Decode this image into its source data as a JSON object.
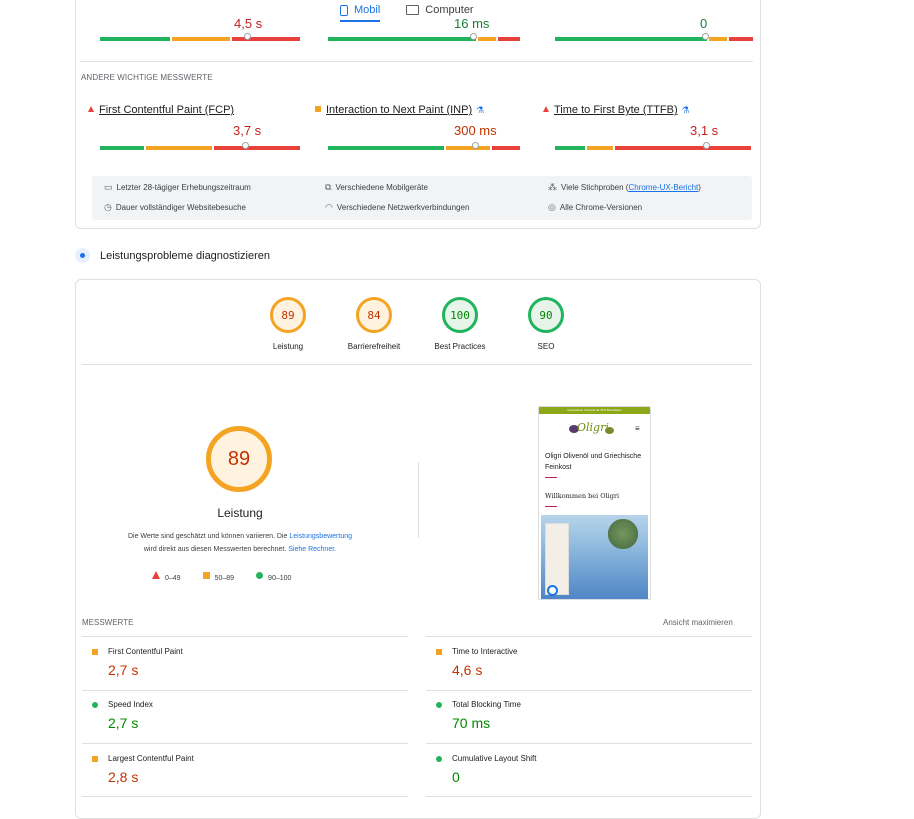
{
  "tabs": [
    {
      "label": "Mobil",
      "active": true
    },
    {
      "label": "Computer",
      "active": false
    }
  ],
  "top_values": [
    "4,5 s",
    "16 ms",
    "0"
  ],
  "other_metrics": {
    "heading": "ANDERE WICHTIGE MESSWERTE",
    "items": [
      {
        "name": "First Contentful Paint (FCP)",
        "value": "3,7 s",
        "status": "poor",
        "experimental": false
      },
      {
        "name": "Interaction to Next Paint (INP)",
        "value": "300 ms",
        "status": "needs-improvement",
        "experimental": true
      },
      {
        "name": "Time to First Byte (TTFB)",
        "value": "3,1 s",
        "status": "poor",
        "experimental": true
      }
    ]
  },
  "info": {
    "period": "Letzter 28-tägiger Erhebungszeitraum",
    "devices": "Verschiedene Mobilgeräte",
    "samples_prefix": "Viele Stichproben (",
    "samples_link": "Chrome-UX-Bericht",
    "samples_suffix": ")",
    "duration": "Dauer vollständiger Websitebesuche",
    "network": "Verschiedene Netzwerkverbindungen",
    "versions": "Alle Chrome-Versionen"
  },
  "diagnose_title": "Leistungsprobleme diagnostizieren",
  "scores": [
    {
      "value": "89",
      "label": "Leistung",
      "color": "#f4a423"
    },
    {
      "value": "84",
      "label": "Barrierefreiheit",
      "color": "#f4a423"
    },
    {
      "value": "100",
      "label": "Best Practices",
      "color": "#21b45d"
    },
    {
      "value": "90",
      "label": "SEO",
      "color": "#21b45d"
    }
  ],
  "performance": {
    "score": "89",
    "label": "Leistung",
    "disclaimer_1": "Die Werte sind geschätzt und können variieren. Die ",
    "disclaimer_link1": "Leistungsbewertung",
    "disclaimer_2": "wird direkt aus diesen Messwerten berechnet. ",
    "disclaimer_link2": "Siehe Rechner.",
    "legend": [
      "0–49",
      "50–89",
      "90–100"
    ]
  },
  "preview": {
    "banner": "Kostenloser Versand ab 30 € Bestellwert",
    "logo": "Oligri",
    "heading": "Oligri Olivenöl und Griechische Feinkost",
    "welcome": "Willkommen bei Oligri"
  },
  "metrics": {
    "heading": "MESSWERTE",
    "expand": "Ansicht maximieren",
    "items": [
      {
        "name": "First Contentful Paint",
        "value": "2,7 s",
        "status": "orange"
      },
      {
        "name": "Time to Interactive",
        "value": "4,6 s",
        "status": "orange"
      },
      {
        "name": "Speed Index",
        "value": "2,7 s",
        "status": "green"
      },
      {
        "name": "Total Blocking Time",
        "value": "70 ms",
        "status": "green"
      },
      {
        "name": "Largest Contentful Paint",
        "value": "2,8 s",
        "status": "orange"
      },
      {
        "name": "Cumulative Layout Shift",
        "value": "0",
        "status": "green"
      }
    ]
  },
  "colors": {
    "good": "#21b45d",
    "average": "#f4a423",
    "poor": "#e8403a",
    "link": "#1a73e8"
  }
}
